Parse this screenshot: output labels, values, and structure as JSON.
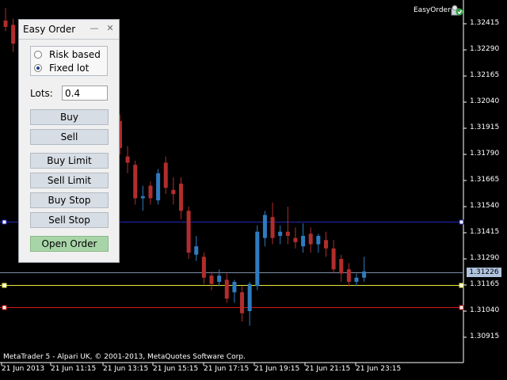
{
  "chart": {
    "price_levels": [
      "1.32415",
      "1.32290",
      "1.32165",
      "1.32040",
      "1.31915",
      "1.31790",
      "1.31665",
      "1.31540",
      "1.31415",
      "1.31290",
      "1.31165",
      "1.31040",
      "1.30915"
    ],
    "time_labels": [
      "21 Jun 2013",
      "21 Jun 11:15",
      "21 Jun 13:15",
      "21 Jun 15:15",
      "21 Jun 17:15",
      "21 Jun 19:15",
      "21 Jun 21:15",
      "21 Jun 23:15"
    ],
    "current_price": "1.31226",
    "copyright": "MetaTrader 5 - Alpari UK, © 2001-2013, MetaQuotes Software Corp.",
    "ea_name": "EasyOrder",
    "colors": {
      "bull": "#2e7bbf",
      "bear": "#b22d2d",
      "blue_line": "#1f2ab8",
      "yellow_line": "#e8e83a",
      "red_line": "#d01919",
      "current_line": "#7d8fa5"
    },
    "candles": [
      {
        "o": 1.3243,
        "h": 1.3249,
        "l": 1.3238,
        "c": 1.324
      },
      {
        "o": 1.3241,
        "h": 1.3244,
        "l": 1.3228,
        "c": 1.3232
      },
      {
        "o": 1.3224,
        "h": 1.3226,
        "l": 1.3214,
        "c": 1.3218
      },
      {
        "o": 1.3215,
        "h": 1.3217,
        "l": 1.3207,
        "c": 1.321
      },
      {
        "o": 1.3208,
        "h": 1.3211,
        "l": 1.32,
        "c": 1.3205
      },
      {
        "o": 1.3212,
        "h": 1.3219,
        "l": 1.3205,
        "c": 1.3208
      },
      {
        "o": 1.321,
        "h": 1.3217,
        "l": 1.3203,
        "c": 1.3207
      },
      {
        "o": 1.3208,
        "h": 1.3211,
        "l": 1.3196,
        "c": 1.3199
      },
      {
        "o": 1.3205,
        "h": 1.3212,
        "l": 1.3196,
        "c": 1.32
      },
      {
        "o": 1.3205,
        "h": 1.3209,
        "l": 1.3198,
        "c": 1.3201
      },
      {
        "o": 1.3202,
        "h": 1.3216,
        "l": 1.3199,
        "c": 1.3204
      },
      {
        "o": 1.3206,
        "h": 1.3208,
        "l": 1.3196,
        "c": 1.3199
      },
      {
        "o": 1.3203,
        "h": 1.3205,
        "l": 1.319,
        "c": 1.3193
      },
      {
        "o": 1.3199,
        "h": 1.3203,
        "l": 1.3194,
        "c": 1.3201
      },
      {
        "o": 1.3199,
        "h": 1.3201,
        "l": 1.319,
        "c": 1.3193
      },
      {
        "o": 1.3195,
        "h": 1.3198,
        "l": 1.3179,
        "c": 1.3182
      },
      {
        "o": 1.3178,
        "h": 1.3183,
        "l": 1.317,
        "c": 1.3175
      },
      {
        "o": 1.3174,
        "h": 1.3176,
        "l": 1.3155,
        "c": 1.3158
      },
      {
        "o": 1.3158,
        "h": 1.3164,
        "l": 1.3152,
        "c": 1.3159
      },
      {
        "o": 1.3164,
        "h": 1.3166,
        "l": 1.3155,
        "c": 1.3158
      },
      {
        "o": 1.3157,
        "h": 1.3172,
        "l": 1.3155,
        "c": 1.317
      },
      {
        "o": 1.3175,
        "h": 1.3178,
        "l": 1.316,
        "c": 1.3163
      },
      {
        "o": 1.3162,
        "h": 1.3168,
        "l": 1.3155,
        "c": 1.316
      },
      {
        "o": 1.3165,
        "h": 1.3168,
        "l": 1.3148,
        "c": 1.3152
      },
      {
        "o": 1.3152,
        "h": 1.3154,
        "l": 1.3129,
        "c": 1.3132
      },
      {
        "o": 1.3131,
        "h": 1.314,
        "l": 1.3128,
        "c": 1.3135
      },
      {
        "o": 1.313,
        "h": 1.3132,
        "l": 1.3117,
        "c": 1.312
      },
      {
        "o": 1.3121,
        "h": 1.3123,
        "l": 1.3114,
        "c": 1.3117
      },
      {
        "o": 1.3118,
        "h": 1.3124,
        "l": 1.3116,
        "c": 1.3121
      },
      {
        "o": 1.3119,
        "h": 1.3122,
        "l": 1.3108,
        "c": 1.311
      },
      {
        "o": 1.3113,
        "h": 1.3119,
        "l": 1.3108,
        "c": 1.3118
      },
      {
        "o": 1.3113,
        "h": 1.3116,
        "l": 1.3099,
        "c": 1.3103
      },
      {
        "o": 1.3104,
        "h": 1.3118,
        "l": 1.3097,
        "c": 1.3117
      },
      {
        "o": 1.3116,
        "h": 1.3145,
        "l": 1.3114,
        "c": 1.3142
      },
      {
        "o": 1.3139,
        "h": 1.3152,
        "l": 1.3135,
        "c": 1.315
      },
      {
        "o": 1.3149,
        "h": 1.3156,
        "l": 1.3136,
        "c": 1.3139
      },
      {
        "o": 1.314,
        "h": 1.3145,
        "l": 1.3136,
        "c": 1.3142
      },
      {
        "o": 1.3142,
        "h": 1.3154,
        "l": 1.3136,
        "c": 1.314
      },
      {
        "o": 1.3139,
        "h": 1.3144,
        "l": 1.3134,
        "c": 1.3137
      },
      {
        "o": 1.3135,
        "h": 1.3146,
        "l": 1.3132,
        "c": 1.314
      },
      {
        "o": 1.3141,
        "h": 1.3144,
        "l": 1.3132,
        "c": 1.3136
      },
      {
        "o": 1.3136,
        "h": 1.3141,
        "l": 1.3132,
        "c": 1.314
      },
      {
        "o": 1.3138,
        "h": 1.3142,
        "l": 1.313,
        "c": 1.3134
      },
      {
        "o": 1.3134,
        "h": 1.3138,
        "l": 1.3122,
        "c": 1.3124
      },
      {
        "o": 1.3129,
        "h": 1.3131,
        "l": 1.3118,
        "c": 1.3122
      },
      {
        "o": 1.3124,
        "h": 1.3127,
        "l": 1.3116,
        "c": 1.3118
      },
      {
        "o": 1.3118,
        "h": 1.3122,
        "l": 1.3116,
        "c": 1.312
      },
      {
        "o": 1.312,
        "h": 1.313,
        "l": 1.3118,
        "c": 1.3123
      }
    ],
    "levels": {
      "blue": 1.31468,
      "yellow": 1.31165,
      "red": 1.3106,
      "current": 1.31226
    },
    "y_range": [
      1.3084,
      1.3252
    ]
  },
  "panel": {
    "title": "Easy Order",
    "minimize_label": "—",
    "close_label": "✕",
    "radio_risk": "Risk based",
    "radio_fixed": "Fixed lot",
    "lots_label": "Lots:",
    "lots_value": "0.4",
    "buttons": {
      "buy": "Buy",
      "sell": "Sell",
      "buy_limit": "Buy Limit",
      "sell_limit": "Sell Limit",
      "buy_stop": "Buy Stop",
      "sell_stop": "Sell Stop",
      "open_order": "Open Order"
    }
  }
}
